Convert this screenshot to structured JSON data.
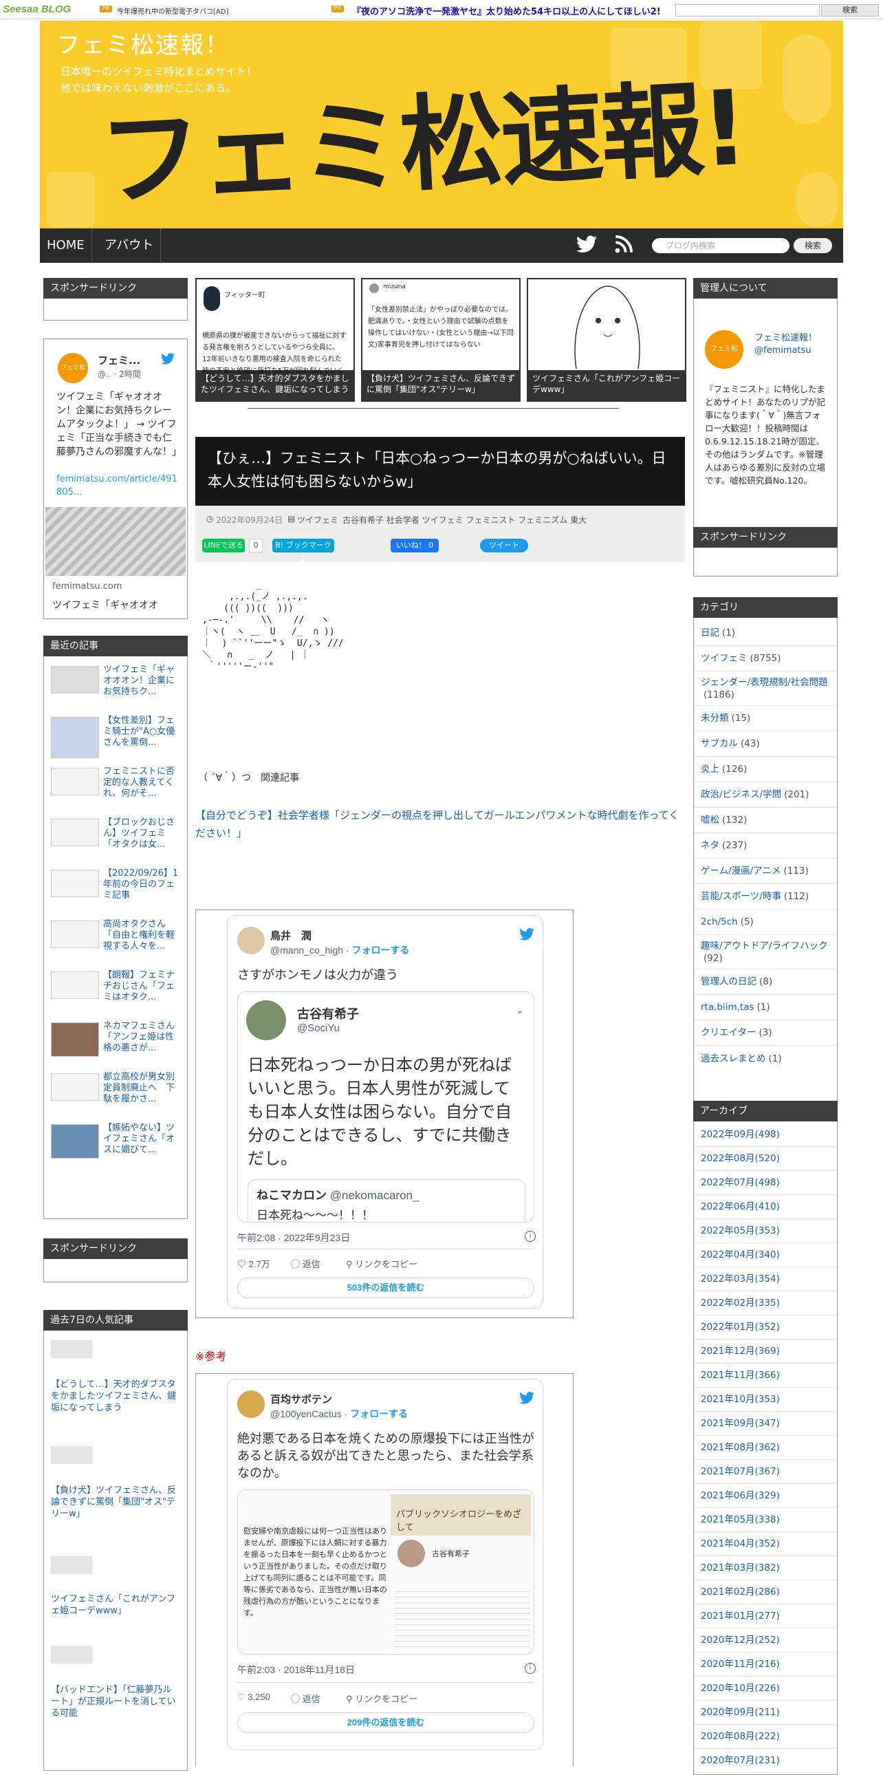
{
  "topbar": {
    "logo": "Seesaa",
    "logo_suffix": "BLOG",
    "pr1": "PR",
    "ad1": "今年爆売れ中の新型電子タバコ[AD]",
    "pr2": "PR",
    "ad2": "『夜のアソコ洗浄で一発激ヤセ』太り始めた54キロ以上の人にしてほしい2!",
    "search_button": "検索"
  },
  "header": {
    "title": "フェミ松速報！",
    "desc_line1": "日本唯一のツイフェミ特化まとめサイト！",
    "desc_line2": "他では味わえない刺激がここにある。",
    "logo_text": "フェミ松速報!"
  },
  "nav": {
    "home": "HOME",
    "about": "アバウト",
    "twitter_icon": "twitter-icon",
    "rss_icon": "rss-icon",
    "search_placeholder": "ブログ内検索",
    "search_button": "検索"
  },
  "left": {
    "sponsor_title": "スポンサードリンク",
    "tweet": {
      "name": "フェミ...",
      "handle": "@.. · 2時間",
      "text": "ツイフェミ「ギャオオオン！企業にお気持ちクレームアタックよ！」 → ツイフェミ「正当な手続きでも仁藤夢乃さんの邪魔すんな！」",
      "link": "femimatsu.com/article/491805...",
      "card_domain": "femimatsu.com",
      "card_title": "ツイフェミ「ギャオオオ"
    },
    "recent_title": "最近の記事",
    "recent": [
      "ツイフェミ「ギャオオオン！企業にお気持ちク...",
      "【女性差別】フェミ騎士が&quot;A○女優さんを罵倒...",
      "フェミニストに否定的な人教えてくれ、何がそ...",
      "【ブロックおじさん】ツイフェミ「オタクは女...",
      "【2022/09/26】1年前の今日のフェミ記事",
      "高尚オタクさん「自由と権利を軽視する人々を...",
      "【朗報】フェミナチおじさん「フェミはオタク...",
      "ネカマフェミさん「アンフェ姫は性格の悪さが...",
      "都立高校が男女別定員制廃止へ　下駄を履かさ...",
      "【嫉妬やない】ツイフェミさん「オスに媚びて..."
    ],
    "sponsor_title2": "スポンサードリンク",
    "popular_title": "過去7日の人気記事",
    "popular": [
      "【どうして…】天才的ダブスタをかましたツイフェミさん、鍵垢になってしまう",
      "【負け犬】ツイフェミさん、反論できずに罵倒「集団&quot;オス&quot;テリーw」",
      "ツイフェミさん「これがアンフェ姫コーデwww」",
      "【バッドエンド】「仁藤夢乃ルート」が正規ルートを消している可能"
    ]
  },
  "thumbs": [
    {
      "caption": "【どうして…】天才的ダブスタをかましたツイフェミさん、鍵垢になってしまう",
      "name": "フィッター町",
      "text": "槻原県の撲が被産できないからって福祉に対する発言権を削ろうとしているやつら全員に、12年前いきなり悪用の検査入院を命じられた時の不安と絶望に皆打ち5万が回れ悩んでいく"
    },
    {
      "caption": "【負け犬】ツイフェミさん、反論できずに罵倒「集団&quot;オス&quot;テリーw」",
      "name": "mizuna",
      "text": "「女性差別禁止法」がやっぱり必要なのでは。肥満ありで。・女性という理由で試験の点数を操作してはいけない・(女性という理由→以下同文)家事育児を押し付けてはならない"
    },
    {
      "caption": "ツイフェミさん「これがアンフェ姫コーデwww」",
      "name": "",
      "text": ""
    }
  ],
  "article": {
    "title": "【ひぇ…】フェミニスト「日本○ねっつーか日本の男が○ねばいい。日本人女性は何も困らないからw」",
    "date": "2022年09月24日",
    "category": "ツイフェミ",
    "tags": "古谷有希子 社会学者 ツイフェミ フェミニスト フェミニズム 東大",
    "line_btn": "LINEで送る",
    "line_count": "0",
    "hatena_btn": "B! ブックマーク",
    "hatena_count": "1",
    "fb_btn": "いいね！",
    "fb_count": "0",
    "tw_btn": "ツイート",
    "aa": "           _\n      ,.,.(_ノ ,.,.,.\n     ((( ))((  )))\n ,-─‐.'     \\\\    //   ヽ\n ｜ヽ(  ヽ ＿  U   /_  ∩ ))\n ｜  ) ``''ーー\"ゝ  U/,ゝ ///\n ＼   ∩   _  ノ   | ｜\n  ｀'''''ー‐''\"       ",
    "related_label": "（ ´∀｀）つ　関連記事",
    "related_link": "【自分でどうぞ】社会学者様「ジェンダーの視点を押し出してガールエンパワメントな時代劇を作ってください！」",
    "ref_label": "※参考"
  },
  "tweet1": {
    "name": "鳥井　潤",
    "handle": "@mann_co_high",
    "follow": "フォローする",
    "text": "さすがホンモノは火力が違う",
    "quoted_name": "古谷有希子",
    "quoted_handle": "@SociYu",
    "quoted_text": "日本死ねっつーか日本の男が死ねばいいと思う。日本人男性が死滅しても日本人女性は困らない。自分で自分のことはできるし、すでに共働きだし。",
    "nested_name": "ねこマカロン",
    "nested_handle": "@nekomacaron_",
    "nested_text": "日本死ね〜〜〜！！！",
    "time": "午前2:08 · 2022年9月23日",
    "likes": "2.7万",
    "reply": "返信",
    "copy": "リンクをコピー",
    "read": "503件の返信を読む"
  },
  "tweet2": {
    "name": "百均サボテン",
    "handle": "@100yenCactus",
    "follow": "フォローする",
    "text": "絶対悪である日本を焼くための原爆投下には正当性があると訴える奴が出てきたと思ったら、また社会学系なのか。",
    "img_text": "慰安婦や南京虐殺には何一つ正当性はありませんが、原爆投下には人類に対する暴力を振るった日本を一刻も早く止めるかつという正当性がありました。その点だけ取り上げても同列に語ることは不可能です。同等に係劣であるなら、正当性が無い日本の残虐行為の方が酷いということになります。",
    "img_book": "パブリックソシオロジーをめざして",
    "img_name": "古谷有希子",
    "time": "午前2:03 · 2018年11月18日",
    "likes": "3,250",
    "reply": "返信",
    "copy": "リンクをコピー",
    "read": "209件の返信を読む"
  },
  "right": {
    "admin_title": "管理人について",
    "admin_name": "フェミ松速報！",
    "admin_handle": "@femimatsu",
    "admin_text": "『フェミニスト』に特化したまとめサイト！あなたのリプが記事になります(＾∀＾)無言フォロー大歓迎！！投稿時間は0.6.9.12.15.18.21時が固定、その他はランダムです。※管理人はあらゆる差別に反対の立場です。嘘松研究員No.120。",
    "sponsor_title": "スポンサードリンク",
    "cat_title": "カテゴリ",
    "categories": [
      {
        "name": "日記",
        "count": "(1)"
      },
      {
        "name": "ツイフェミ",
        "count": "(8755)"
      },
      {
        "name": "ジェンダー/表現規制/社会問題",
        "count": "(1186)"
      },
      {
        "name": "未分類",
        "count": "(15)"
      },
      {
        "name": "サブカル",
        "count": "(43)"
      },
      {
        "name": "炎上",
        "count": "(126)"
      },
      {
        "name": "政治/ビジネス/学問",
        "count": "(201)"
      },
      {
        "name": "嘘松",
        "count": "(132)"
      },
      {
        "name": "ネタ",
        "count": "(237)"
      },
      {
        "name": "ゲーム/漫画/アニメ",
        "count": "(113)"
      },
      {
        "name": "芸能/スポーツ/時事",
        "count": "(112)"
      },
      {
        "name": "2ch/5ch",
        "count": "(5)"
      },
      {
        "name": "趣味/アウトドア/ライフハック",
        "count": "(92)"
      },
      {
        "name": "管理人の日記",
        "count": "(8)"
      },
      {
        "name": "rta,biim,tas",
        "count": "(1)"
      },
      {
        "name": "クリエイター",
        "count": "(3)"
      },
      {
        "name": "過去スレまとめ",
        "count": "(1)"
      }
    ],
    "archive_title": "アーカイブ",
    "archives": [
      "2022年09月(498)",
      "2022年08月(520)",
      "2022年07月(498)",
      "2022年06月(410)",
      "2022年05月(353)",
      "2022年04月(340)",
      "2022年03月(354)",
      "2022年02月(335)",
      "2022年01月(352)",
      "2021年12月(369)",
      "2021年11月(366)",
      "2021年10月(353)",
      "2021年09月(347)",
      "2021年08月(362)",
      "2021年07月(367)",
      "2021年06月(329)",
      "2021年05月(338)",
      "2021年04月(352)",
      "2021年03月(382)",
      "2021年02月(286)",
      "2021年01月(277)",
      "2020年12月(252)",
      "2020年11月(216)",
      "2020年10月(226)",
      "2020年09月(211)",
      "2020年08月(222)",
      "2020年07月(231)"
    ]
  },
  "colors": {
    "header_yellow": "#f8cd2c",
    "nav_dark": "#2b2b2b",
    "link_blue": "#1a5fb4",
    "twitter_blue": "#1d9bf0",
    "ref_red": "#cc0000"
  }
}
